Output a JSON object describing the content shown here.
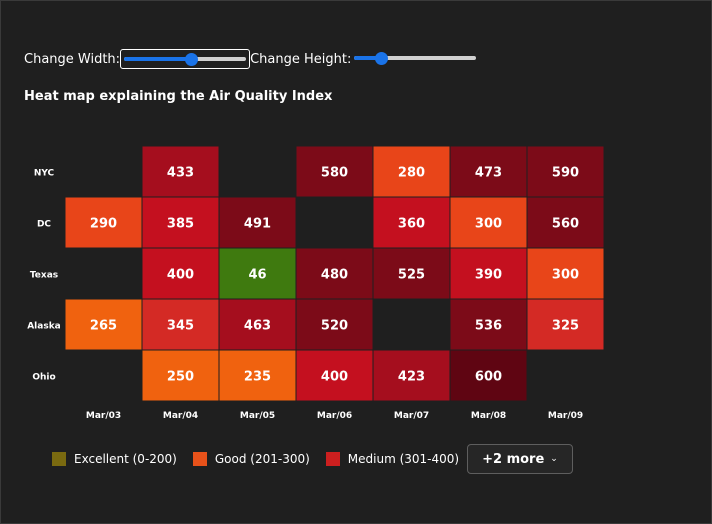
{
  "controls": {
    "width_label": "Change Width:",
    "width_level": 0.55,
    "height_label": "Change Height:",
    "height_level": 0.22
  },
  "chart_data": {
    "type": "heatmap",
    "title": "Heat map explaining the Air Quality Index",
    "x_categories": [
      "Mar/03",
      "Mar/04",
      "Mar/05",
      "Mar/06",
      "Mar/07",
      "Mar/08",
      "Mar/09"
    ],
    "y_categories": [
      "NYC",
      "DC",
      "Texas",
      "Alaska",
      "Ohio"
    ],
    "values": [
      [
        null,
        433,
        null,
        580,
        280,
        473,
        590
      ],
      [
        290,
        385,
        491,
        null,
        360,
        300,
        560
      ],
      [
        null,
        400,
        46,
        480,
        525,
        390,
        300
      ],
      [
        265,
        345,
        463,
        520,
        null,
        536,
        325
      ],
      [
        null,
        250,
        235,
        400,
        423,
        600,
        null
      ]
    ],
    "legend": [
      {
        "label": "Excellent (0-200)",
        "color": "#7a6a10"
      },
      {
        "label": "Good (201-300)",
        "color": "#e8521a"
      },
      {
        "label": "Medium (301-400)",
        "color": "#cc1f1f"
      }
    ],
    "legend_more_label": "+2 more"
  },
  "colors": {
    "background": "#1f1f1f",
    "excellent": "#3f7a0f",
    "good_low": "#f0620f",
    "good_high": "#e84519",
    "medium_low": "#d42a25",
    "medium_high": "#c4101f",
    "poor_low": "#a50e1e",
    "poor_high": "#7c0b18",
    "severe": "#5f0512"
  }
}
